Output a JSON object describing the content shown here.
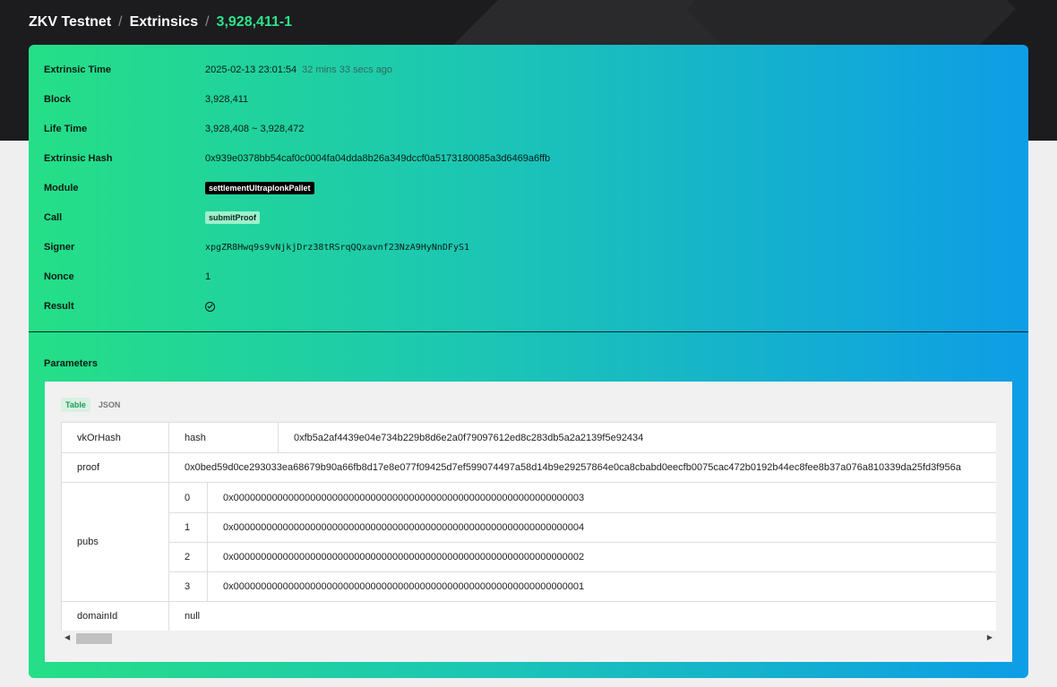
{
  "breadcrumb": {
    "network": "ZKV Testnet",
    "section": "Extrinsics",
    "current": "3,928,411-1",
    "separator": "/"
  },
  "details": {
    "extrinsic_time_label": "Extrinsic Time",
    "extrinsic_time_value": "2025-02-13 23:01:54",
    "extrinsic_time_ago": "32 mins 33 secs ago",
    "block_label": "Block",
    "block_value": "3,928,411",
    "lifetime_label": "Life Time",
    "lifetime_value": "3,928,408 ~ 3,928,472",
    "hash_label": "Extrinsic Hash",
    "hash_value": "0x939e0378bb54caf0c0004fa04dda8b26a349dccf0a5173180085a3d6469a6ffb",
    "module_label": "Module",
    "module_value": "settlementUltraplonkPallet",
    "call_label": "Call",
    "call_value": "submitProof",
    "signer_label": "Signer",
    "signer_value": "xpgZR8Hwq9s9vNjkjDrz38tRSrqQQxavnf23NzA9HyNnDFyS1",
    "nonce_label": "Nonce",
    "nonce_value": "1",
    "result_label": "Result",
    "result_icon": "check-circle-icon"
  },
  "parameters": {
    "title": "Parameters",
    "tabs": [
      "Table",
      "JSON"
    ],
    "active_tab": "Table",
    "rows": {
      "vk_name": "vkOrHash",
      "vk_type": "hash",
      "vk_value": "0xfb5a2af4439e04e734b229b8d6e2a0f79097612ed8c283db5a2a2139f5e92434",
      "proof_name": "proof",
      "proof_value": "0x0bed59d0ce293033ea68679b90a66fb8d17e8e077f09425d7ef599074497a58d14b9e29257864e0ca8cbabd0eecfb0075cac472b0192b44ec8fee8b37a076a810339da25fd3f956a",
      "pubs_name": "pubs",
      "pubs": [
        {
          "index": "0",
          "value": "0x0000000000000000000000000000000000000000000000000000000000000003"
        },
        {
          "index": "1",
          "value": "0x0000000000000000000000000000000000000000000000000000000000000004"
        },
        {
          "index": "2",
          "value": "0x0000000000000000000000000000000000000000000000000000000000000002"
        },
        {
          "index": "3",
          "value": "0x0000000000000000000000000000000000000000000000000000000000000001"
        }
      ],
      "domain_name": "domainId",
      "domain_value": "null"
    }
  },
  "colors": {
    "accent_green": "#2ee38a",
    "gradient_start": "#25df86",
    "gradient_end": "#0e9de6"
  }
}
